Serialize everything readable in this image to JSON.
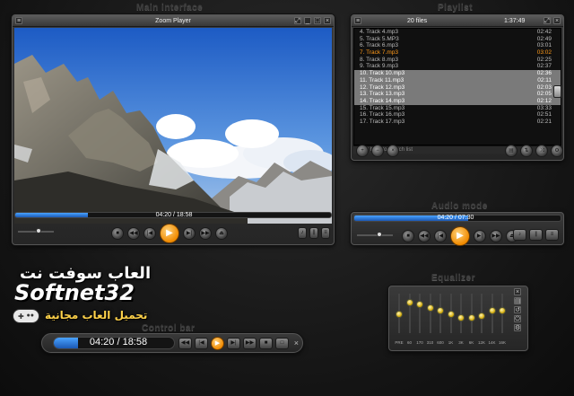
{
  "labels": {
    "main_interface": "Main interface",
    "playlist": "Playlist",
    "audio_mode": "Audio mode",
    "equalizer": "Equalizer",
    "control_bar": "Control bar"
  },
  "main": {
    "title": "Zoom Player",
    "time": "04:20 / 18:58",
    "progress": 0.23
  },
  "playlist": {
    "count": "20 files",
    "total_time": "1:37:49",
    "search_hint": "Click here to search list",
    "tracks": [
      {
        "name": "4. Track 4.mp3",
        "dur": "02:42",
        "state": "normal"
      },
      {
        "name": "5. Track 5.MP3",
        "dur": "02:49",
        "state": "normal"
      },
      {
        "name": "6. Track 6.mp3",
        "dur": "03:01",
        "state": "normal"
      },
      {
        "name": "7. Track 7.mp3",
        "dur": "03:02",
        "state": "current"
      },
      {
        "name": "8. Track 8.mp3",
        "dur": "02:25",
        "state": "normal"
      },
      {
        "name": "9. Track 9.mp3",
        "dur": "02:37",
        "state": "normal"
      },
      {
        "name": "10. Track 10.mp3",
        "dur": "02:36",
        "state": "selected"
      },
      {
        "name": "11. Track 11.mp3",
        "dur": "02:11",
        "state": "selected"
      },
      {
        "name": "12. Track 12.mp3",
        "dur": "02:03",
        "state": "selected"
      },
      {
        "name": "13. Track 13.mp3",
        "dur": "02:05",
        "state": "selected"
      },
      {
        "name": "14. Track 14.mp3",
        "dur": "02:12",
        "state": "selected"
      },
      {
        "name": "15. Track 15.mp3",
        "dur": "03:33",
        "state": "normal"
      },
      {
        "name": "16. Track 16.mp3",
        "dur": "02:51",
        "state": "normal"
      },
      {
        "name": "17. Track 17.mp3",
        "dur": "02:21",
        "state": "normal"
      }
    ]
  },
  "audio": {
    "time": "04:20 / 07:30",
    "progress": 0.55
  },
  "equalizer": {
    "bands": [
      "PRE",
      "60",
      "170",
      "310",
      "600",
      "1K",
      "3K",
      "6K",
      "12K",
      "14K",
      "16K"
    ],
    "levels": [
      0.5,
      0.15,
      0.2,
      0.3,
      0.4,
      0.5,
      0.6,
      0.6,
      0.55,
      0.4,
      0.4
    ]
  },
  "control_bar": {
    "time": "04:20 / 18:58",
    "progress": 0.2
  },
  "watermark": {
    "arabic_title": "العاب سوفت نت",
    "brand": "Softnet32",
    "arabic_sub": "تحميل العاب مجانية"
  },
  "colors": {
    "accent": "#f08a00",
    "seek": "#2f7fe0",
    "current_track": "#ff9a1a"
  }
}
